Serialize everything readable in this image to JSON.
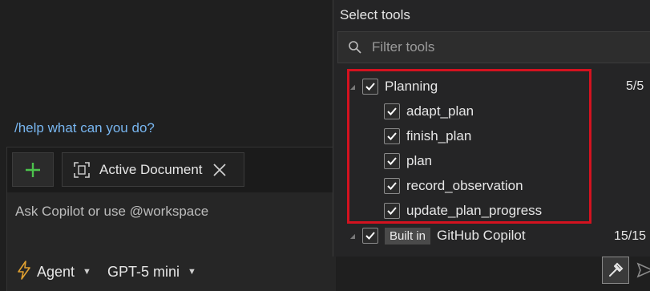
{
  "chat": {
    "help_link": "/help what can you do?",
    "add_label": "+",
    "context_chip": "Active Document",
    "input_placeholder": "Ask Copilot or use @workspace",
    "mode_label": "Agent",
    "model_label": "GPT-5 mini"
  },
  "tools_panel": {
    "title": "Select tools",
    "filter_placeholder": "Filter tools",
    "groups": [
      {
        "label": "Planning",
        "count": "5/5",
        "checked": true,
        "items": [
          {
            "label": "adapt_plan",
            "checked": true
          },
          {
            "label": "finish_plan",
            "checked": true
          },
          {
            "label": "plan",
            "checked": true
          },
          {
            "label": "record_observation",
            "checked": true
          },
          {
            "label": "update_plan_progress",
            "checked": true
          }
        ]
      },
      {
        "badge": "Built in",
        "label": "GitHub Copilot",
        "count": "15/15",
        "checked": true
      }
    ]
  },
  "colors": {
    "accent_green": "#4cc24c",
    "highlight_red": "#d4121f",
    "link_blue": "#78b6f0"
  }
}
